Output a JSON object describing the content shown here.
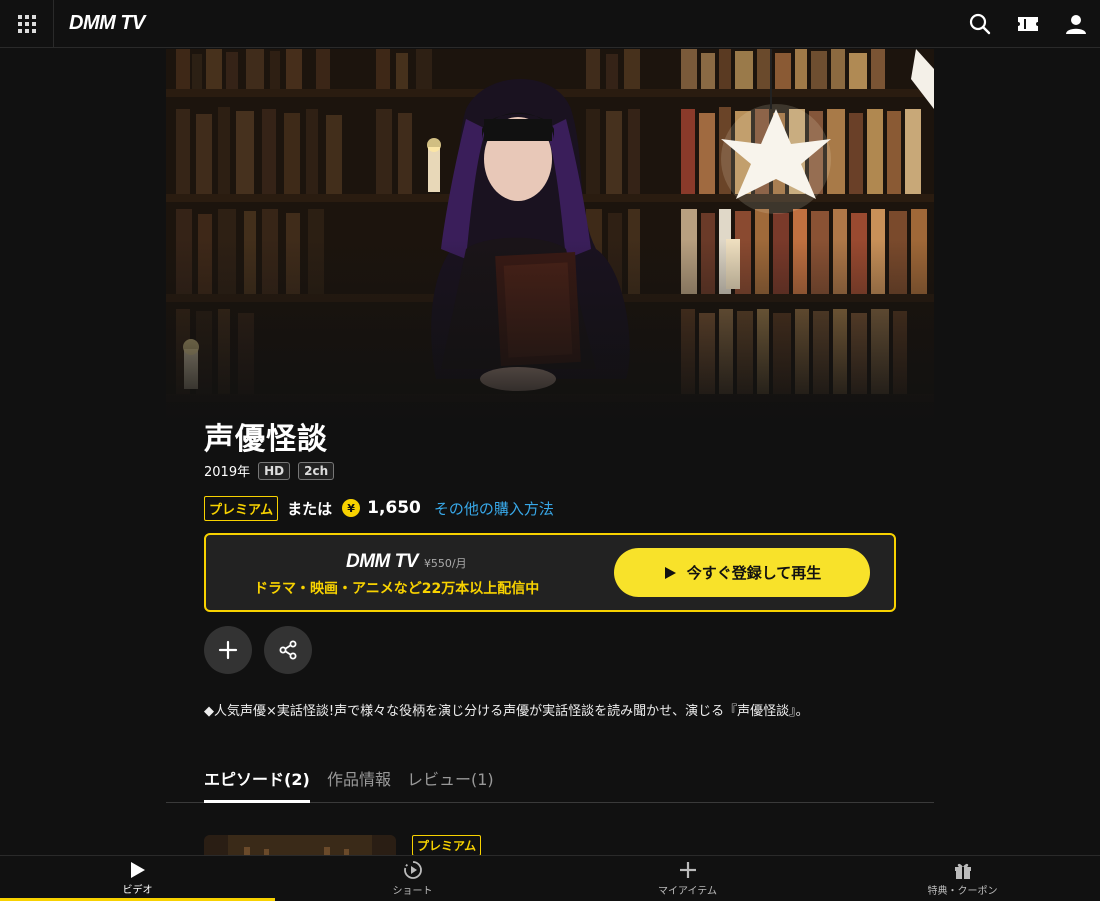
{
  "header": {
    "logo": "DMM TV"
  },
  "title": {
    "main": "声優怪談",
    "year": "2019年",
    "tags": [
      "HD",
      "2ch"
    ]
  },
  "price": {
    "premium_label": "プレミアム",
    "or_label": "または",
    "coin_symbol": "¥",
    "amount": "1,650",
    "other_purchase": "その他の購入方法"
  },
  "promo": {
    "logo": "DMM TV",
    "price": "¥550/月",
    "subtitle": "ドラマ・映画・アニメなど22万本以上配信中",
    "button_label": "今すぐ登録して再生"
  },
  "description": "◆人気声優×実話怪談!声で様々な役柄を演じ分ける声優が実話怪談を読み聞かせ、演じる『声優怪談』。",
  "tabs": [
    {
      "label": "エピソード(2)",
      "active": true
    },
    {
      "label": "作品情報",
      "active": false
    },
    {
      "label": "レビュー(1)",
      "active": false
    }
  ],
  "episode": {
    "premium_label": "プレミアム"
  },
  "bottom_nav": [
    {
      "label": "ビデオ",
      "icon": "play-icon",
      "active": true
    },
    {
      "label": "ショート",
      "icon": "short-play-icon",
      "active": false
    },
    {
      "label": "マイアイテム",
      "icon": "plus-icon",
      "active": false
    },
    {
      "label": "特典・クーポン",
      "icon": "gift-icon",
      "active": false
    }
  ],
  "colors": {
    "accent": "#f8d200",
    "link": "#38a8e8",
    "background": "#111111"
  }
}
